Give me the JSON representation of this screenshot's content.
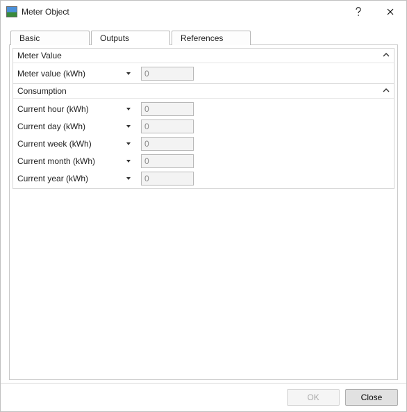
{
  "window": {
    "title": "Meter Object"
  },
  "tabs": {
    "basic": "Basic",
    "outputs": "Outputs",
    "references": "References"
  },
  "sections": {
    "meter_value": {
      "title": "Meter Value",
      "rows": {
        "meter_value": {
          "label": "Meter value (kWh)",
          "value": "0"
        }
      }
    },
    "consumption": {
      "title": "Consumption",
      "rows": {
        "current_hour": {
          "label": "Current hour (kWh)",
          "value": "0"
        },
        "current_day": {
          "label": "Current day (kWh)",
          "value": "0"
        },
        "current_week": {
          "label": "Current week (kWh)",
          "value": "0"
        },
        "current_month": {
          "label": "Current month (kWh)",
          "value": "0"
        },
        "current_year": {
          "label": "Current year (kWh)",
          "value": "0"
        }
      }
    }
  },
  "footer": {
    "ok": "OK",
    "close": "Close"
  }
}
